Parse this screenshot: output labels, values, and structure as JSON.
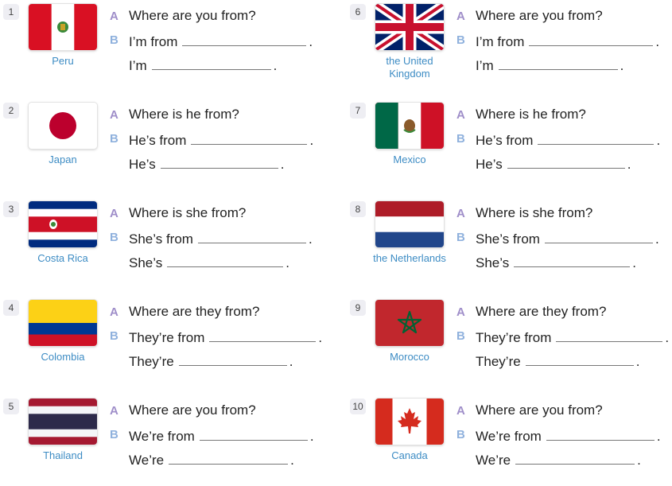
{
  "items": [
    {
      "num": "1",
      "flag_icon": "peru-flag-icon",
      "country": "Peru",
      "a": "Where are you from?",
      "b": "I’m from",
      "c": "I’m"
    },
    {
      "num": "2",
      "flag_icon": "japan-flag-icon",
      "country": "Japan",
      "a": "Where is he from?",
      "b": "He’s from",
      "c": "He’s"
    },
    {
      "num": "3",
      "flag_icon": "costa-rica-flag-icon",
      "country": "Costa Rica",
      "a": "Where is she from?",
      "b": "She’s from",
      "c": "She’s"
    },
    {
      "num": "4",
      "flag_icon": "colombia-flag-icon",
      "country": "Colombia",
      "a": "Where are they from?",
      "b": "They’re from",
      "c": "They’re"
    },
    {
      "num": "5",
      "flag_icon": "thailand-flag-icon",
      "country": "Thailand",
      "a": "Where are you from?",
      "b": "We’re from",
      "c": "We’re"
    },
    {
      "num": "6",
      "flag_icon": "united-kingdom-flag-icon",
      "country": "the United Kingdom",
      "a": "Where are you from?",
      "b": "I’m from",
      "c": "I’m"
    },
    {
      "num": "7",
      "flag_icon": "mexico-flag-icon",
      "country": "Mexico",
      "a": "Where is he from?",
      "b": "He’s from",
      "c": "He’s"
    },
    {
      "num": "8",
      "flag_icon": "netherlands-flag-icon",
      "country": "the Netherlands",
      "a": "Where is she from?",
      "b": "She’s from",
      "c": "She’s"
    },
    {
      "num": "9",
      "flag_icon": "morocco-flag-icon",
      "country": "Morocco",
      "a": "Where are they from?",
      "b": "They’re from",
      "c": "They’re"
    },
    {
      "num": "10",
      "flag_icon": "canada-flag-icon",
      "country": "Canada",
      "a": "Where are you from?",
      "b": "We’re from",
      "c": "We’re"
    }
  ],
  "labels": {
    "a": "A",
    "b": "B",
    "dot": "."
  },
  "colors": {
    "country_text": "#3d8cc4",
    "label_a": "#9f8ec9",
    "label_b": "#8fb1dd"
  }
}
